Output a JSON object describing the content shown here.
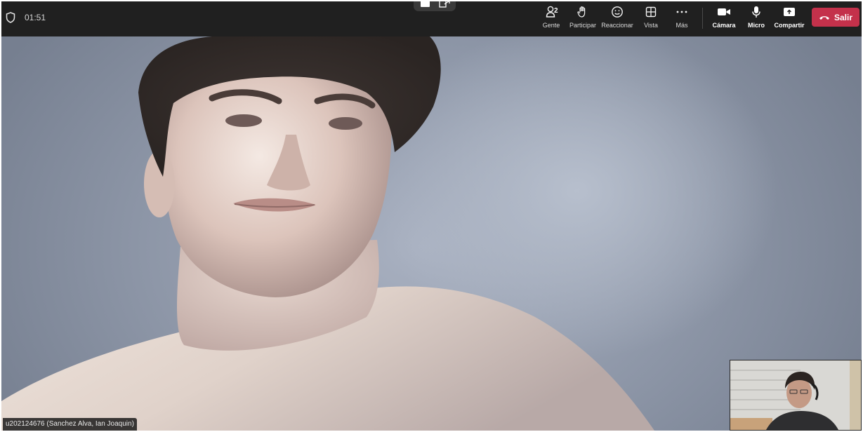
{
  "meeting": {
    "timer": "01:51"
  },
  "toolbar": {
    "people": {
      "label": "Gente",
      "count": "2",
      "icon": "people-icon"
    },
    "raise_hand": {
      "label": "Participar",
      "icon": "raise-hand-icon"
    },
    "react": {
      "label": "Reaccionar",
      "icon": "smiley-icon"
    },
    "view": {
      "label": "Vista",
      "icon": "view-grid-icon"
    },
    "more": {
      "label": "Más",
      "icon": "ellipsis-icon"
    },
    "camera": {
      "label": "Cámara",
      "icon": "camera-icon"
    },
    "mic": {
      "label": "Micro",
      "icon": "microphone-icon"
    },
    "share": {
      "label": "Compartir",
      "icon": "share-screen-icon"
    },
    "leave": {
      "label": "Salir",
      "icon": "hang-up-icon"
    }
  },
  "participant": {
    "name": "u202124676 (Sanchez Alva, Ian Joaquin)"
  },
  "colors": {
    "topbar": "#202020",
    "leave_button": "#c4314b",
    "name_tag_bg": "#141414"
  }
}
